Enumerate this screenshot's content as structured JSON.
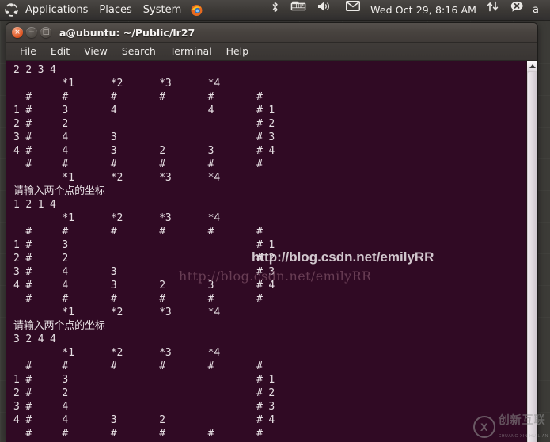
{
  "panel": {
    "logo_icon": "ubuntu-logo-icon",
    "menus": [
      "Applications",
      "Places",
      "System"
    ],
    "firefox_icon": "firefox-icon",
    "indicators": [
      {
        "name": "bluetooth-icon",
        "glyph": "✶"
      },
      {
        "name": "keyboard-icon",
        "glyph": "⌨"
      },
      {
        "name": "volume-icon",
        "glyph": "🔊"
      },
      {
        "name": "mail-icon",
        "glyph": "✉"
      }
    ],
    "clock": "Wed Oct 29,  8:16 AM",
    "network_icon": "network-updown-icon",
    "messaging_icon": "messaging-error-icon",
    "user": "a"
  },
  "window": {
    "title": "a@ubuntu: ~/Public/lr27",
    "close_label": "×",
    "minimize_label": "−",
    "maximize_label": "□",
    "menu": [
      "File",
      "Edit",
      "View",
      "Search",
      "Terminal",
      "Help"
    ]
  },
  "terminal": {
    "content": "2 2 3 4\n        *1      *2      *3      *4\n  #     #       #       #       #       #\n1 #     3       4               4       # 1\n2 #     2                               # 2\n3 #     4       3                       # 3\n4 #     4       3       2       3       # 4\n  #     #       #       #       #       #\n        *1      *2      *3      *4\n请输入两个点的坐标\n1 2 1 4\n        *1      *2      *3      *4\n  #     #       #       #       #       #\n1 #     3                               # 1\n2 #     2                               # 2\n3 #     4       3                       # 3\n4 #     4       3       2       3       # 4\n  #     #       #       #       #       #\n        *1      *2      *3      *4\n请输入两个点的坐标\n3 2 4 4\n        *1      *2      *3      *4\n  #     #       #       #       #       #\n1 #     3                               # 1\n2 #     2                               # 2\n3 #     4                               # 3\n4 #     4       3       2               # 4\n  #     #       #       #       #       #",
    "prompt_cn": "请输入两个点的坐标",
    "inputs": [
      "2 2 3 4",
      "1 2 1 4",
      "3 2 4 4"
    ],
    "bg_color": "#300a24",
    "fg_color": "#e6dfe3"
  },
  "scrollbar": {
    "up_arrow_icon": "scroll-up-arrow-icon"
  },
  "watermarks": {
    "bold_url": "http://blog.csdn.net/emilyRR",
    "serif_url": "http://blog.csdn.net/emilyRR",
    "logo_mark": "X",
    "logo_cn": "创新互联",
    "logo_en": "CHUANG XIN HU LIAN"
  }
}
